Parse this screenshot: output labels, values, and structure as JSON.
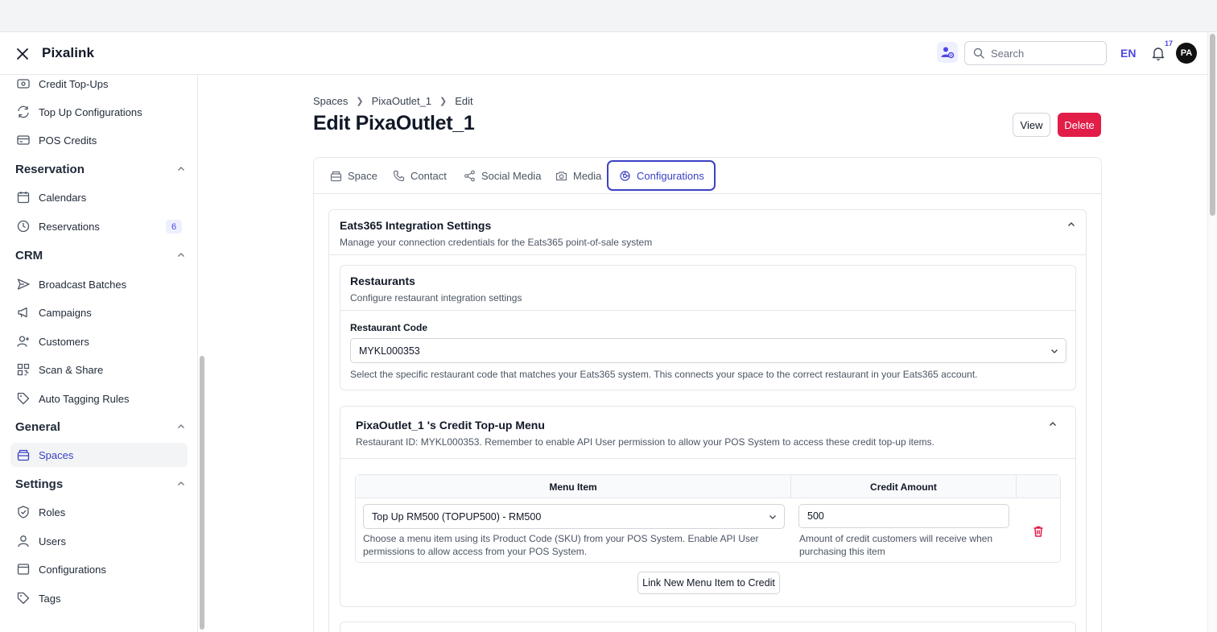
{
  "app": {
    "name": "Pixalink"
  },
  "header": {
    "search_placeholder": "Search",
    "language": "EN",
    "notification_count": "17",
    "avatar_initials": "PA"
  },
  "sidebar": {
    "items_top": [
      {
        "label": "Credit Top-Ups",
        "icon": "credit-topup-icon"
      },
      {
        "label": "Top Up Configurations",
        "icon": "refresh-icon"
      },
      {
        "label": "POS Credits",
        "icon": "card-icon"
      }
    ],
    "reservation": {
      "title": "Reservation",
      "items": [
        {
          "label": "Calendars"
        },
        {
          "label": "Reservations",
          "badge": "6"
        }
      ]
    },
    "crm": {
      "title": "CRM",
      "items": [
        {
          "label": "Broadcast Batches"
        },
        {
          "label": "Campaigns"
        },
        {
          "label": "Customers"
        },
        {
          "label": "Scan & Share"
        },
        {
          "label": "Auto Tagging Rules"
        }
      ]
    },
    "general": {
      "title": "General",
      "items": [
        {
          "label": "Spaces"
        }
      ]
    },
    "settings": {
      "title": "Settings",
      "items": [
        {
          "label": "Roles"
        },
        {
          "label": "Users"
        },
        {
          "label": "Configurations"
        },
        {
          "label": "Tags"
        }
      ]
    }
  },
  "breadcrumb": [
    "Spaces",
    "PixaOutlet_1",
    "Edit"
  ],
  "page": {
    "title": "Edit PixaOutlet_1",
    "view_label": "View",
    "delete_label": "Delete"
  },
  "tabs": [
    "Space",
    "Contact",
    "Social Media",
    "Media",
    "Configurations"
  ],
  "eats365": {
    "title": "Eats365 Integration Settings",
    "description": "Manage your connection credentials for the Eats365 point-of-sale system",
    "restaurants": {
      "title": "Restaurants",
      "description": "Configure restaurant integration settings",
      "code_label": "Restaurant Code",
      "code_value": "MYKL000353",
      "help": "Select the specific restaurant code that matches your Eats365 system. This connects your space to the correct restaurant in your Eats365 account."
    },
    "credit_menu": {
      "title": "PixaOutlet_1 's Credit Top-up Menu",
      "description": "Restaurant ID: MYKL000353. Remember to enable API User permission to allow your POS System to access these credit top-up items.",
      "col_menu_item": "Menu Item",
      "col_credit_amount": "Credit Amount",
      "row": {
        "menu_item": "Top Up RM500 (TOPUP500) - RM500",
        "credit_amount": "500",
        "menu_help": "Choose a menu item using its Product Code (SKU) from your POS System. Enable API User permissions to allow access from your POS System.",
        "credit_help": "Amount of credit customers will receive when purchasing this item"
      },
      "link_button": "Link New Menu Item to Credit"
    }
  },
  "colors": {
    "accent": "#3b41c5",
    "danger": "#e11d48"
  }
}
